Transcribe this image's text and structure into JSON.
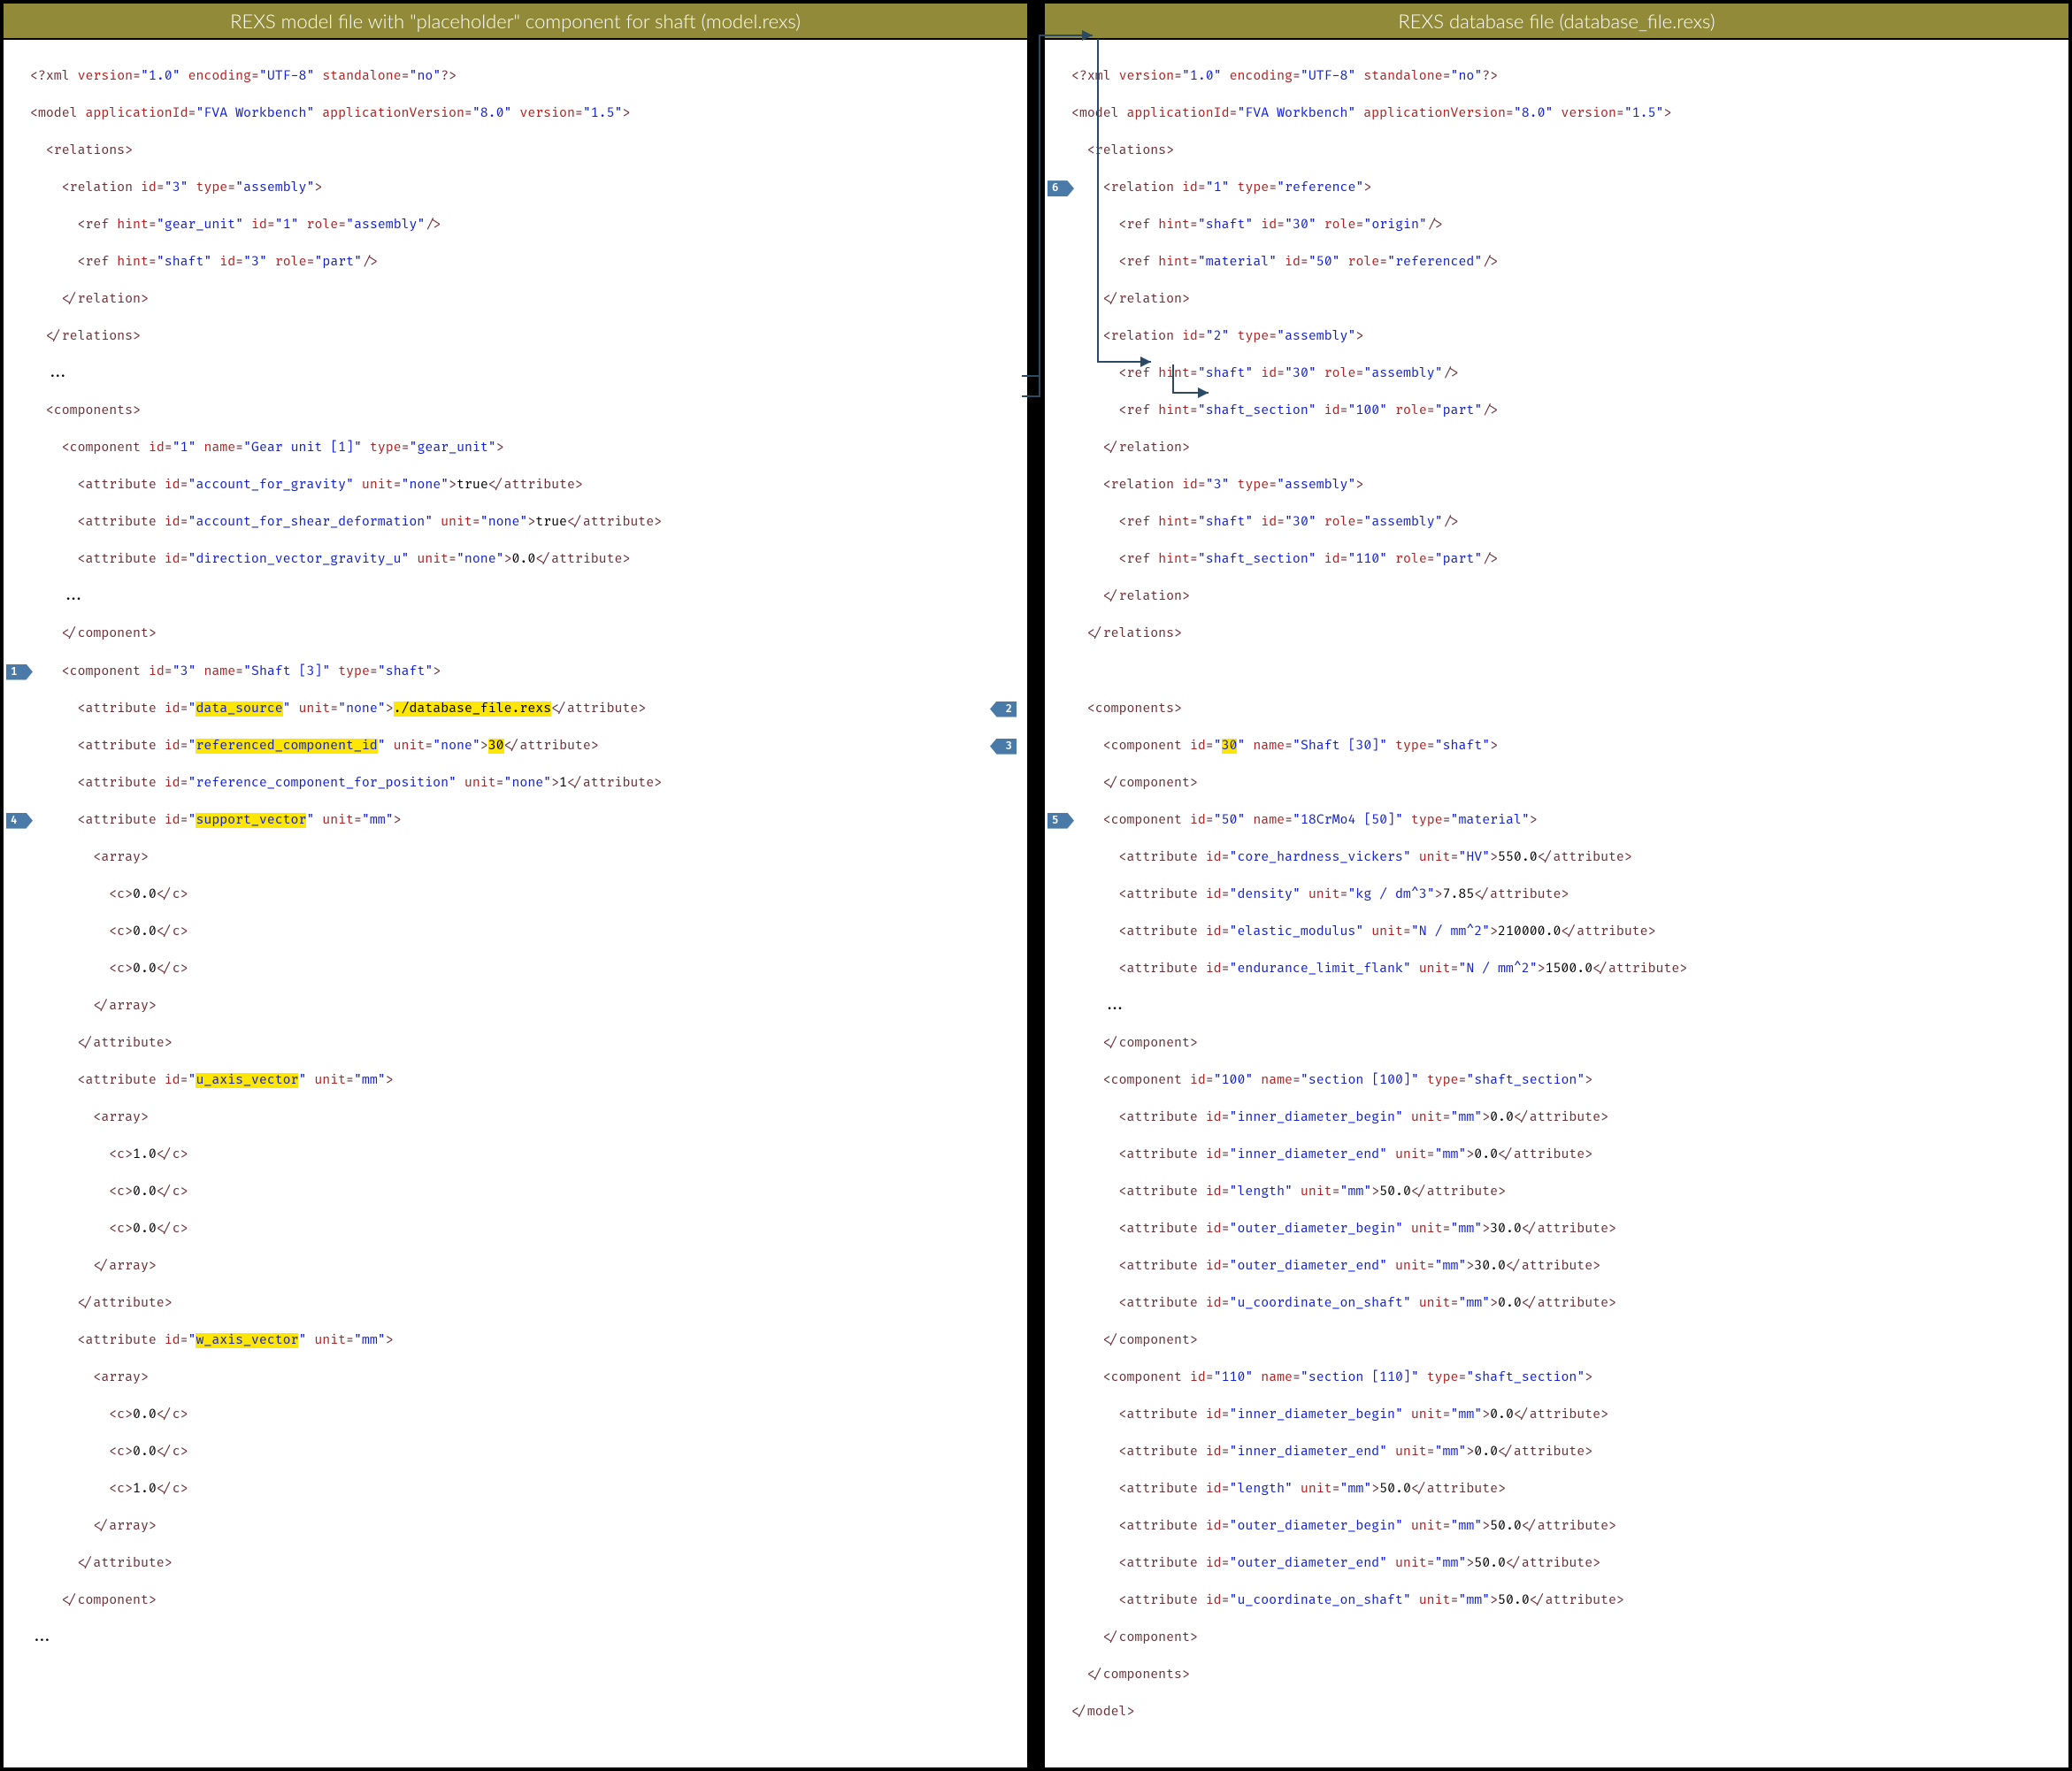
{
  "left": {
    "title": "REXS model file with \"placeholder\" component for shaft (model.rexs)",
    "xml_decl": {
      "version": "1.0",
      "encoding": "UTF-8",
      "standalone": "no"
    },
    "model_attrs": {
      "applicationId": "FVA Workbench",
      "applicationVersion": "8.0",
      "version": "1.5"
    },
    "rel3": {
      "id": "3",
      "type": "assembly",
      "refs": [
        {
          "hint": "gear_unit",
          "id": "1",
          "role": "assembly"
        },
        {
          "hint": "shaft",
          "id": "3",
          "role": "part"
        }
      ]
    },
    "comp1": {
      "id": "1",
      "name": "Gear unit [1]",
      "type": "gear_unit",
      "attrs": [
        {
          "id": "account_for_gravity",
          "unit": "none",
          "val": "true"
        },
        {
          "id": "account_for_shear_deformation",
          "unit": "none",
          "val": "true"
        },
        {
          "id": "direction_vector_gravity_u",
          "unit": "none",
          "val": "0.0"
        }
      ]
    },
    "comp3": {
      "id": "3",
      "name": "Shaft [3]",
      "type": "shaft",
      "data_source": {
        "id": "data_source",
        "unit": "none",
        "val": "./database_file.rexs"
      },
      "ref_comp_id": {
        "id": "referenced_component_id",
        "unit": "none",
        "val": "30"
      },
      "ref_comp_pos": {
        "id": "reference_component_for_position",
        "unit": "none",
        "val": "1"
      },
      "support_vector": {
        "id": "support_vector",
        "unit": "mm",
        "c": [
          "0.0",
          "0.0",
          "0.0"
        ]
      },
      "u_axis_vector": {
        "id": "u_axis_vector",
        "unit": "mm",
        "c": [
          "1.0",
          "0.0",
          "0.0"
        ]
      },
      "w_axis_vector": {
        "id": "w_axis_vector",
        "unit": "mm",
        "c": [
          "0.0",
          "0.0",
          "1.0"
        ]
      }
    },
    "markers": {
      "m1": "1",
      "m2": "2",
      "m3": "3",
      "m4": "4"
    }
  },
  "right": {
    "title": "REXS database file (database_file.rexs)",
    "xml_decl": {
      "version": "1.0",
      "encoding": "UTF-8",
      "standalone": "no"
    },
    "model_attrs": {
      "applicationId": "FVA Workbench",
      "applicationVersion": "8.0",
      "version": "1.5"
    },
    "rel1": {
      "id": "1",
      "type": "reference",
      "refs": [
        {
          "hint": "shaft",
          "id": "30",
          "role": "origin"
        },
        {
          "hint": "material",
          "id": "50",
          "role": "referenced"
        }
      ]
    },
    "rel2": {
      "id": "2",
      "type": "assembly",
      "refs": [
        {
          "hint": "shaft",
          "id": "30",
          "role": "assembly"
        },
        {
          "hint": "shaft_section",
          "id": "100",
          "role": "part"
        }
      ]
    },
    "rel3": {
      "id": "3",
      "type": "assembly",
      "refs": [
        {
          "hint": "shaft",
          "id": "30",
          "role": "assembly"
        },
        {
          "hint": "shaft_section",
          "id": "110",
          "role": "part"
        }
      ]
    },
    "comp30": {
      "id": "30",
      "name": "Shaft [30]",
      "type": "shaft"
    },
    "comp50": {
      "id": "50",
      "name": "18CrMo4 [50]",
      "type": "material",
      "attrs": [
        {
          "id": "core_hardness_vickers",
          "unit": "HV",
          "val": "550.0"
        },
        {
          "id": "density",
          "unit": "kg / dm^3",
          "val": "7.85"
        },
        {
          "id": "elastic_modulus",
          "unit": "N / mm^2",
          "val": "210000.0"
        },
        {
          "id": "endurance_limit_flank",
          "unit": "N / mm^2",
          "val": "1500.0"
        }
      ]
    },
    "comp100": {
      "id": "100",
      "name": "section [100]",
      "type": "shaft_section",
      "attrs": [
        {
          "id": "inner_diameter_begin",
          "unit": "mm",
          "val": "0.0"
        },
        {
          "id": "inner_diameter_end",
          "unit": "mm",
          "val": "0.0"
        },
        {
          "id": "length",
          "unit": "mm",
          "val": "50.0"
        },
        {
          "id": "outer_diameter_begin",
          "unit": "mm",
          "val": "30.0"
        },
        {
          "id": "outer_diameter_end",
          "unit": "mm",
          "val": "30.0"
        },
        {
          "id": "u_coordinate_on_shaft",
          "unit": "mm",
          "val": "0.0"
        }
      ]
    },
    "comp110": {
      "id": "110",
      "name": "section [110]",
      "type": "shaft_section",
      "attrs": [
        {
          "id": "inner_diameter_begin",
          "unit": "mm",
          "val": "0.0"
        },
        {
          "id": "inner_diameter_end",
          "unit": "mm",
          "val": "0.0"
        },
        {
          "id": "length",
          "unit": "mm",
          "val": "50.0"
        },
        {
          "id": "outer_diameter_begin",
          "unit": "mm",
          "val": "50.0"
        },
        {
          "id": "outer_diameter_end",
          "unit": "mm",
          "val": "50.0"
        },
        {
          "id": "u_coordinate_on_shaft",
          "unit": "mm",
          "val": "50.0"
        }
      ]
    },
    "markers": {
      "m5": "5",
      "m6": "6"
    }
  }
}
